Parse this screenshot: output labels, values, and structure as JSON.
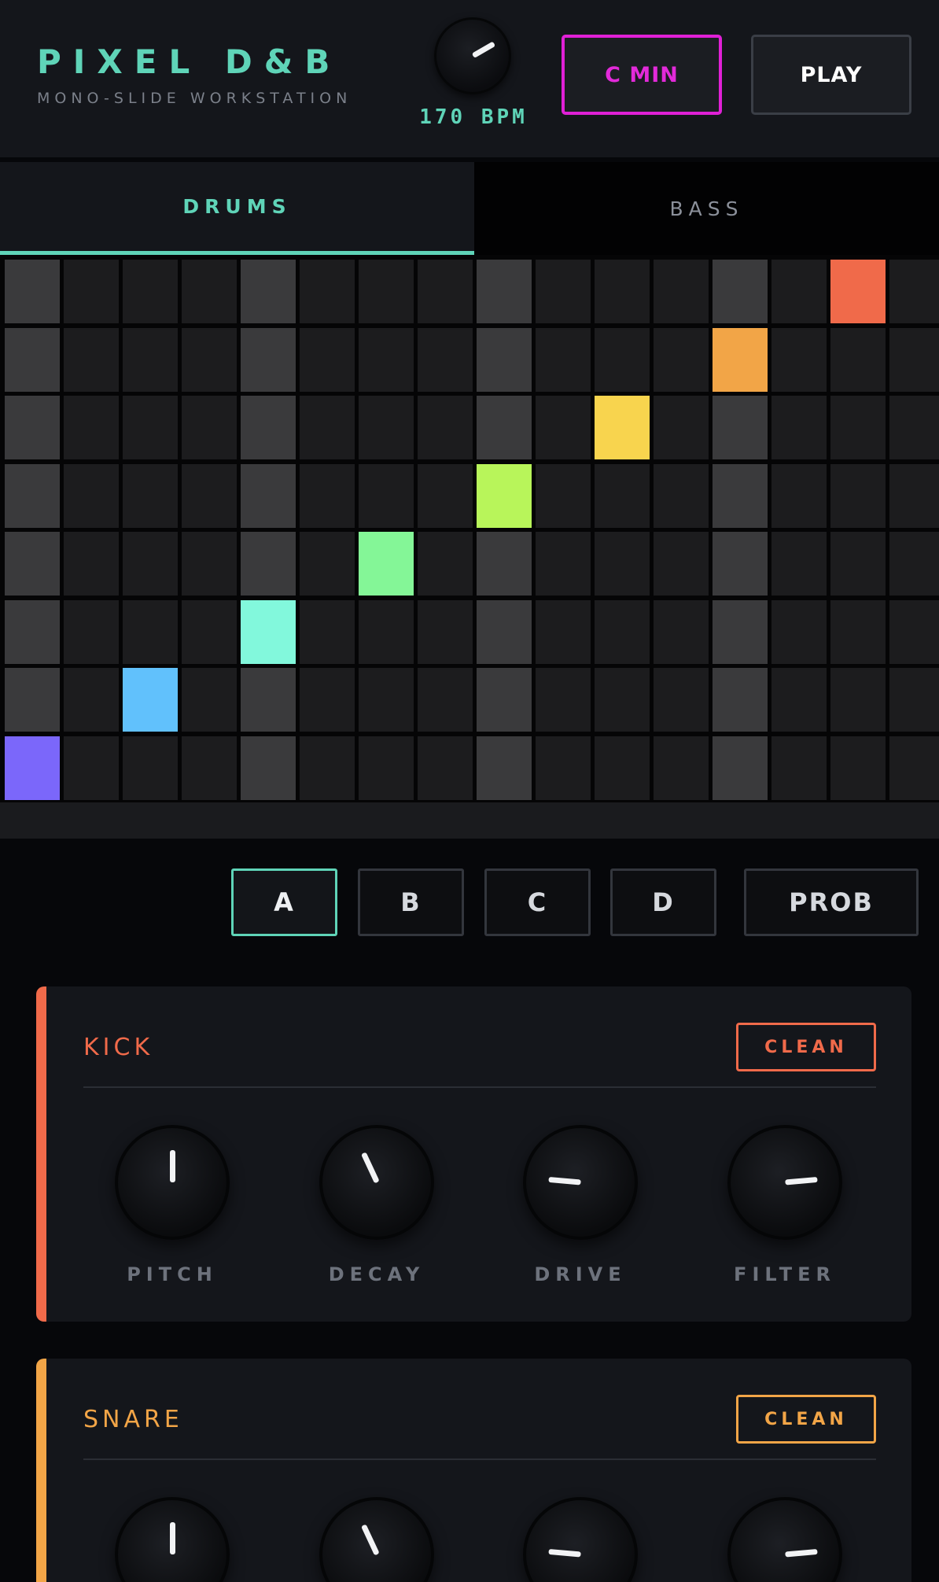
{
  "header": {
    "title": "PIXEL D&B",
    "subtitle": "MONO-SLIDE WORKSTATION",
    "tempo_label": "170 BPM",
    "tempo_value": 170,
    "key_label": "C MIN",
    "play_label": "PLAY",
    "accent": "#5fd4b8",
    "key_color": "#e020d6"
  },
  "tabs": [
    {
      "label": "DRUMS",
      "active": true
    },
    {
      "label": "BASS",
      "active": false
    }
  ],
  "sequencer": {
    "rows": 8,
    "columns": 16,
    "beat_columns": [
      0,
      4,
      8,
      12
    ],
    "active_steps": [
      {
        "row": 0,
        "col": 14,
        "color": "#f06a4a"
      },
      {
        "row": 1,
        "col": 12,
        "color": "#f2a547"
      },
      {
        "row": 2,
        "col": 10,
        "color": "#f8d44e"
      },
      {
        "row": 3,
        "col": 8,
        "color": "#b8f55a"
      },
      {
        "row": 4,
        "col": 6,
        "color": "#84f697"
      },
      {
        "row": 5,
        "col": 4,
        "color": "#82f8dc"
      },
      {
        "row": 6,
        "col": 2,
        "color": "#61c1fc"
      },
      {
        "row": 7,
        "col": 0,
        "color": "#7b67fa"
      }
    ]
  },
  "patterns": {
    "buttons": [
      {
        "label": "A",
        "active": true
      },
      {
        "label": "B",
        "active": false
      },
      {
        "label": "C",
        "active": false
      },
      {
        "label": "D",
        "active": false
      }
    ],
    "prob_label": "PROB"
  },
  "instruments": [
    {
      "name": "KICK",
      "color": "#f06a4a",
      "mode_label": "CLEAN",
      "knobs": [
        {
          "label": "PITCH",
          "rotation_deg": 0
        },
        {
          "label": "DECAY",
          "rotation_deg": -25
        },
        {
          "label": "DRIVE",
          "rotation_deg": -85
        },
        {
          "label": "FILTER",
          "rotation_deg": 85
        }
      ]
    },
    {
      "name": "SNARE",
      "color": "#f2a547",
      "mode_label": "CLEAN",
      "knobs": [
        {
          "label": "",
          "rotation_deg": 0
        },
        {
          "label": "",
          "rotation_deg": -25
        },
        {
          "label": "",
          "rotation_deg": -85
        },
        {
          "label": "",
          "rotation_deg": 85
        }
      ]
    }
  ]
}
